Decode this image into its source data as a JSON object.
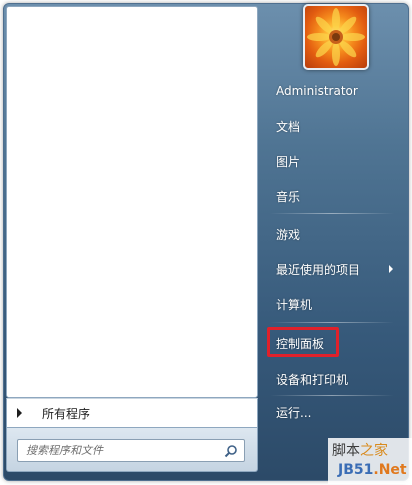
{
  "left_pane": {
    "all_programs_label": "所有程序",
    "search_placeholder": "搜索程序和文件"
  },
  "right_pane": {
    "items": [
      {
        "label": "Administrator"
      },
      {
        "label": "文档"
      },
      {
        "label": "图片"
      },
      {
        "label": "音乐"
      },
      {
        "label": "游戏"
      },
      {
        "label": "最近使用的项目",
        "has_submenu": true
      },
      {
        "label": "计算机"
      },
      {
        "label": "控制面板",
        "highlighted": true
      },
      {
        "label": "设备和打印机"
      },
      {
        "label": "运行..."
      }
    ]
  },
  "watermark": {
    "line1_a": "脚本",
    "line1_b": "之家",
    "line2_a": "JB51",
    "line2_b": ".Net"
  },
  "colors": {
    "highlight": "#e0212b",
    "menu_blue": "#3d6282"
  },
  "icons": {
    "user_avatar": "orange-flower-picture",
    "search": "magnifier-icon"
  }
}
